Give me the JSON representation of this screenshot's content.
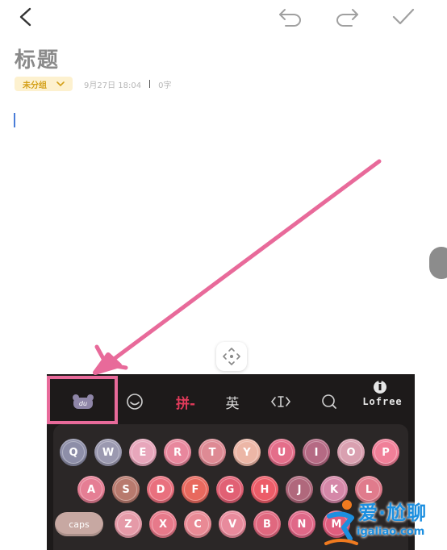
{
  "colors": {
    "accent_arrow": "#e86a9a",
    "keyboard_bg": "#1d1a1a",
    "pinyin_red": "#e03a5a",
    "category_bg": "#fdf1cf",
    "category_text": "#d4a01a",
    "watermark_blue": "#1c8fe0"
  },
  "header": {
    "icons": {
      "back": "chevron-left-icon",
      "undo": "undo-icon",
      "redo": "redo-icon",
      "done": "check-icon"
    }
  },
  "note": {
    "title": "标题",
    "category": "未分组",
    "date": "9月27日 18:04",
    "word_count": "0字"
  },
  "keyboard": {
    "toolbar": {
      "logo_icon": "du-bear-icon",
      "emoji_icon": "smiley-icon",
      "pinyin_label": "拼-",
      "english_label": "英",
      "cursor_icon": "cursor-move-icon",
      "search_icon": "search-icon",
      "brand_label": "Lofree"
    },
    "rows": [
      [
        "Q",
        "W",
        "E",
        "R",
        "T",
        "Y",
        "U",
        "I",
        "O",
        "P"
      ],
      [
        "A",
        "S",
        "D",
        "F",
        "G",
        "H",
        "J",
        "K",
        "L"
      ],
      [
        "Z",
        "X",
        "C",
        "V",
        "B",
        "N",
        "M"
      ]
    ],
    "caps_label": "caps"
  },
  "watermark": {
    "top_text": "爱·尬聊",
    "bottom_text": "igaliao.com"
  }
}
